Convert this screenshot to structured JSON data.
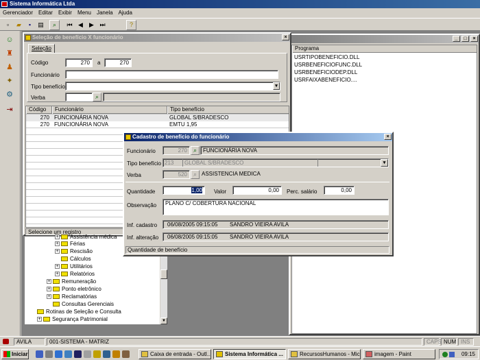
{
  "app": {
    "title": "Sistema Informática Ltda"
  },
  "menu": [
    "Gerenciador",
    "Editar",
    "Exibir",
    "Menu",
    "Janela",
    "Ajuda"
  ],
  "programs_window": {
    "column": "Programa",
    "items": [
      "USRTIPOBENEFICIO.DLL",
      "USRBENEFICIOFUNC.DLL",
      "USRBENEFICIODEP.DLL",
      "USRFAIXABENEFICIO...."
    ]
  },
  "selection_window": {
    "title": "Seleção de benefício X funcionário",
    "tab": "Seleção",
    "codigo_label": "Código",
    "codigo_from": "270",
    "a_label": "a",
    "codigo_to": "270",
    "funcionario_label": "Funcionário",
    "tipo_label": "Tipo benefício",
    "verba_label": "Verba",
    "grid": {
      "headers": [
        "Código",
        "Funcionário",
        "Tipo benefício"
      ],
      "rows": [
        [
          "270",
          "FUNCIONÁRIA NOVA",
          "GLOBAL S/BRADESCO"
        ],
        [
          "270",
          "FUNCIONÁRIA NOVA",
          "EMTU 1,95"
        ]
      ]
    },
    "status": "Selecione um registro"
  },
  "tree": {
    "items": [
      {
        "label": "Assistência médica",
        "level": 3
      },
      {
        "label": "Férias",
        "level": 3
      },
      {
        "label": "Rescisão",
        "level": 3
      },
      {
        "label": "Cálculos",
        "level": 3
      },
      {
        "label": "Utilitários",
        "level": 3
      },
      {
        "label": "Relatórios",
        "level": 3
      },
      {
        "label": "Remuneração",
        "level": 2
      },
      {
        "label": "Ponto eletrônico",
        "level": 2
      },
      {
        "label": "Reclamatórias",
        "level": 2
      },
      {
        "label": "Consultas Gerenciais",
        "level": 2
      },
      {
        "label": "Rotinas de Seleção e Consulta",
        "level": 1
      },
      {
        "label": "Segurança Patrimonial",
        "level": 1
      }
    ]
  },
  "cadastro_window": {
    "title": "Cadastro de benefício do funcionário",
    "funcionario_label": "Funcionário",
    "funcionario_code": "270",
    "funcionario_name": "FUNCIONÁRIA NOVA",
    "tipo_label": "Tipo benefício",
    "tipo_code": "213",
    "tipo_name": "GLOBAL S/BRADESCO",
    "verba_label": "Verba",
    "verba_code": "520",
    "verba_name": "ASSISTENCIA MEDICA",
    "quantidade_label": "Quantidade",
    "quantidade_value": "1,00",
    "valor_label": "Valor",
    "valor_value": "0,00",
    "perc_label": "Perc. salário",
    "perc_value": "0,00",
    "observacao_label": "Observação",
    "observacao_value": "PLANO C/ COBERTURA NACIONAL",
    "inf_cadastro_label": "Inf. cadastro",
    "inf_cadastro_date": "06/08/2005 09:15:05",
    "inf_cadastro_user": "SANDRO VIEIRA AVILA",
    "inf_alteracao_label": "Inf. alteração",
    "inf_alteracao_date": "06/08/2005 09:15:05",
    "inf_alteracao_user": "SANDRO VIEIRA AVILA",
    "status": "Quantidade de benefício"
  },
  "statusbar": {
    "user": "AVILA",
    "system": "001-SISTEMA - MATRIZ",
    "caps": "CAPS",
    "num": "NUM",
    "ins": "INS"
  },
  "taskbar": {
    "start": "Iniciar",
    "buttons": [
      "Caixa de entrada - Outl...",
      "Sistema Informática ...",
      "RecursosHumanos - Micr...",
      "imagem - Paint"
    ],
    "clock": "09:15"
  }
}
